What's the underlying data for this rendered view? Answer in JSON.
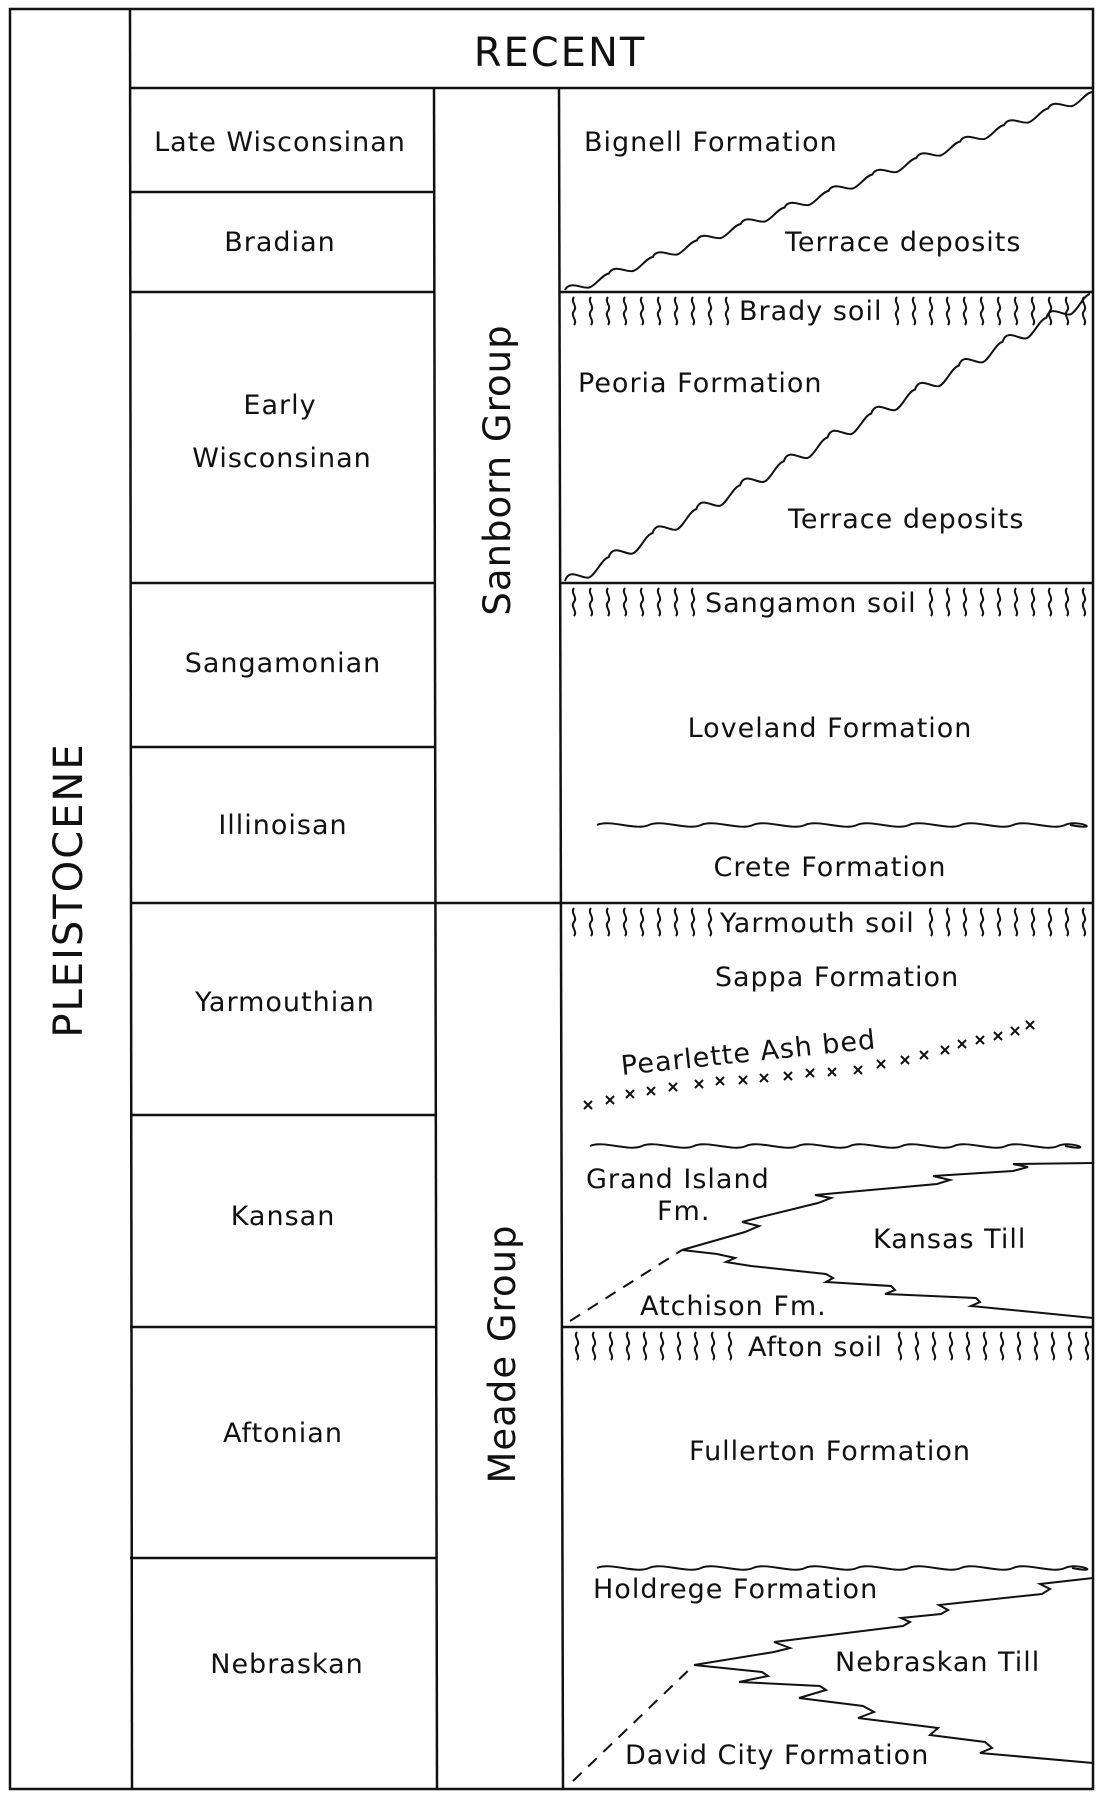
{
  "title": "Stratigraphic column: Pleistocene and Recent deposits",
  "epochs": {
    "recent": "RECENT",
    "pleistocene": "PLEISTOCENE"
  },
  "stages": [
    {
      "name": "Late Wisconsinan"
    },
    {
      "name": "Bradian"
    },
    {
      "name": "Early Wisconsinan",
      "lines": [
        "Early",
        "Wisconsinan"
      ]
    },
    {
      "name": "Sangamonian"
    },
    {
      "name": "Illinoisan"
    },
    {
      "name": "Yarmouthian"
    },
    {
      "name": "Kansan"
    },
    {
      "name": "Aftonian"
    },
    {
      "name": "Nebraskan"
    }
  ],
  "groups": [
    {
      "name": "Sanborn Group"
    },
    {
      "name": "Meade Group"
    }
  ],
  "soils": [
    {
      "name": "Brady soil"
    },
    {
      "name": "Sangamon soil"
    },
    {
      "name": "Yarmouth soil"
    },
    {
      "name": "Afton soil"
    }
  ],
  "units": {
    "bignell": "Bignell Formation",
    "terrace1": "Terrace deposits",
    "peoria": "Peoria Formation",
    "terrace2": "Terrace deposits",
    "loveland": "Loveland Formation",
    "crete": "Crete Formation",
    "sappa": "Sappa Formation",
    "pearlette": "Pearlette Ash bed",
    "grand_island_1": "Grand Island",
    "grand_island_2": "Fm.",
    "kansas_till": "Kansas Till",
    "atchison": "Atchison Fm.",
    "fullerton": "Fullerton Formation",
    "holdrege": "Holdrege Formation",
    "nebraskan_till": "Nebraskan Till",
    "david_city": "David City Formation"
  }
}
